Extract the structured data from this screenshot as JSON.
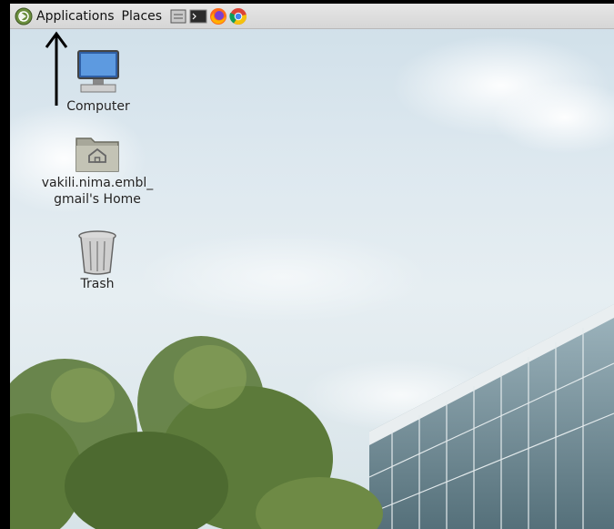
{
  "topbar": {
    "apps_icon": "distributor-logo-icon",
    "applications_label": "Applications",
    "places_label": "Places",
    "launchers": [
      "file-manager-icon",
      "terminal-icon",
      "firefox-icon",
      "chrome-icon"
    ]
  },
  "desktop": {
    "icons": [
      {
        "label": "Computer",
        "icon": "computer-icon"
      },
      {
        "label_line1": "vakili.nima.embl_",
        "label_line2": "gmail's Home",
        "icon": "home-folder-icon"
      },
      {
        "label": "Trash",
        "icon": "trash-icon"
      }
    ],
    "annotation": "up-arrow-annotation"
  },
  "colors": {
    "panel": "#dedede",
    "sky": "#dbe7ee",
    "tree": "#5c7a3a",
    "building": "#6f8c96"
  }
}
